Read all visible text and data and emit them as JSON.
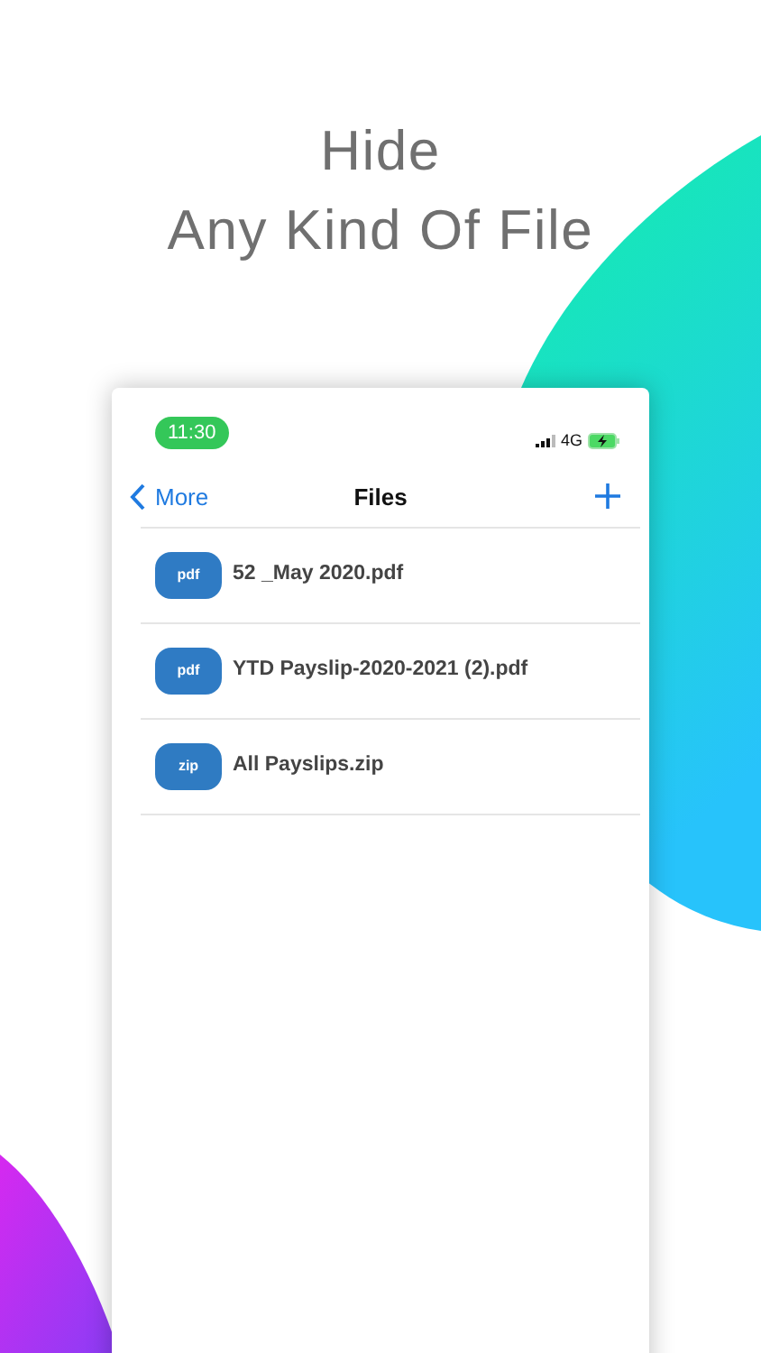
{
  "headline": [
    "Hide",
    "Any Kind Of File"
  ],
  "status_bar": {
    "time": "11:30",
    "network": "4G"
  },
  "nav": {
    "back": "More",
    "title": "Files"
  },
  "files": [
    {
      "type": "pdf",
      "name": "52 _May 2020.pdf"
    },
    {
      "type": "pdf",
      "name": "YTD Payslip-2020-2021 (2).pdf"
    },
    {
      "type": "zip",
      "name": "All Payslips.zip"
    }
  ]
}
